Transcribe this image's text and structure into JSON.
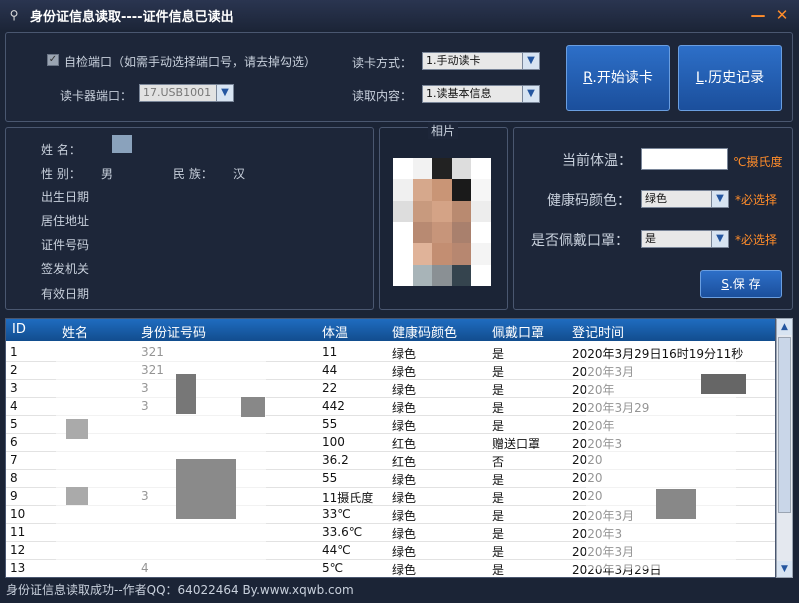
{
  "window": {
    "title": "身份证信息读取----证件信息已读出",
    "icon": "id-card-icon",
    "min_glyph": "—",
    "close_glyph": "✕"
  },
  "top": {
    "auto_check_label": "自检端口（如需手动选择端口号，请去掉勾选）",
    "reader_port_label": "读卡器端口：",
    "reader_port_value": "17.USB1001",
    "read_mode_label": "读卡方式：",
    "read_mode_value": "1.手动读卡",
    "read_content_label": "读取内容：",
    "read_content_value": "1.读基本信息",
    "start_button_key": "R",
    "start_button_label": ".开始读卡",
    "history_button_key": "L",
    "history_button_label": ".历史记录"
  },
  "info": {
    "name_label": "姓    名：",
    "gender_label": "性    别：",
    "gender_value": "男",
    "ethnicity_label": "民    族：",
    "ethnicity_value": "汉",
    "birth_label": "出生日期",
    "address_label": "居住地址",
    "idnum_label": "证件号码",
    "issuer_label": "签发机关",
    "valid_label": "有效日期",
    "photo_title": "相片"
  },
  "health": {
    "temp_label": "当前体温：",
    "temp_unit": "℃摄氏度",
    "color_label": "健康码颜色：",
    "color_value": "绿色",
    "required1": "*必选择",
    "mask_label": "是否佩戴口罩：",
    "mask_value": "是",
    "required2": "*必选择",
    "save_key": "S",
    "save_label": ".保 存"
  },
  "table": {
    "headers": [
      "ID",
      "姓名",
      "身份证号码",
      "体温",
      "健康码颜色",
      "佩戴口罩",
      "登记时间"
    ],
    "rows": [
      {
        "id": "1",
        "idnum": "321",
        "temp": "11",
        "color": "绿色",
        "mask": "是",
        "time": "2020年3月29日16时19分11秒"
      },
      {
        "id": "2",
        "idnum": "321",
        "temp": "44",
        "color": "绿色",
        "mask": "是",
        "time": "2020年3月"
      },
      {
        "id": "3",
        "idnum": "3",
        "temp": "22",
        "color": "绿色",
        "mask": "是",
        "time": "2020年"
      },
      {
        "id": "4",
        "idnum": "3",
        "temp": "442",
        "color": "绿色",
        "mask": "是",
        "time": "2020年3月29"
      },
      {
        "id": "5",
        "idnum": "",
        "temp": "55",
        "color": "绿色",
        "mask": "是",
        "time": "2020年"
      },
      {
        "id": "6",
        "idnum": "",
        "temp": "100",
        "color": "红色",
        "mask": "赠送口罩",
        "time": "2020年3"
      },
      {
        "id": "7",
        "idnum": "",
        "temp": "36.2",
        "color": "红色",
        "mask": "否",
        "time": "2020"
      },
      {
        "id": "8",
        "idnum": "",
        "temp": "55",
        "color": "绿色",
        "mask": "是",
        "time": "2020"
      },
      {
        "id": "9",
        "idnum": "3",
        "temp": "11摄氏度",
        "color": "绿色",
        "mask": "是",
        "time": "2020"
      },
      {
        "id": "10",
        "idnum": "",
        "temp": "33℃",
        "color": "绿色",
        "mask": "是",
        "time": "2020年3月"
      },
      {
        "id": "11",
        "idnum": "",
        "temp": "33.6℃",
        "color": "绿色",
        "mask": "是",
        "time": "2020年3"
      },
      {
        "id": "12",
        "idnum": "",
        "temp": "44℃",
        "color": "绿色",
        "mask": "是",
        "time": "2020年3月"
      },
      {
        "id": "13",
        "idnum": "4",
        "temp": "5℃",
        "color": "绿色",
        "mask": "是",
        "time": "2020年3月29日"
      }
    ]
  },
  "status": {
    "text": "身份证信息读取成功--作者QQ：64022464 By.www.xqwb.com"
  }
}
